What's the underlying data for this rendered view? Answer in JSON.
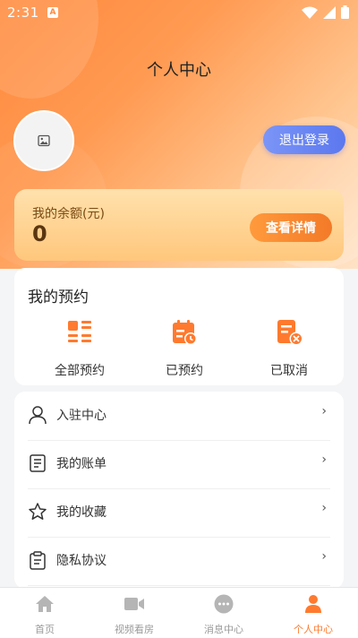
{
  "status_bar": {
    "time": "2:31",
    "badge": "A"
  },
  "header": {
    "title": "个人中心",
    "logout_label": "退出登录"
  },
  "balance": {
    "label": "我的余额(元)",
    "amount": "0",
    "details_label": "查看详情"
  },
  "reservations": {
    "title": "我的预约",
    "items": [
      {
        "label": "全部预约",
        "icon": "grid-list-icon"
      },
      {
        "label": "已预约",
        "icon": "calendar-clock-icon"
      },
      {
        "label": "已取消",
        "icon": "document-cancel-icon"
      }
    ]
  },
  "menu": {
    "chevron": "›",
    "items": [
      {
        "label": "入驻中心",
        "icon": "user-icon"
      },
      {
        "label": "我的账单",
        "icon": "bill-icon"
      },
      {
        "label": "我的收藏",
        "icon": "star-icon"
      },
      {
        "label": "隐私协议",
        "icon": "clipboard-icon"
      }
    ]
  },
  "tabs": [
    {
      "label": "首页",
      "icon": "home-icon",
      "active": false
    },
    {
      "label": "视频看房",
      "icon": "video-icon",
      "active": false
    },
    {
      "label": "消息中心",
      "icon": "message-icon",
      "active": false
    },
    {
      "label": "个人中心",
      "icon": "person-icon",
      "active": true
    }
  ],
  "colors": {
    "accent": "#ff7a2e",
    "logout": "#5b78ee",
    "tab_inactive": "#b5b5b5"
  }
}
